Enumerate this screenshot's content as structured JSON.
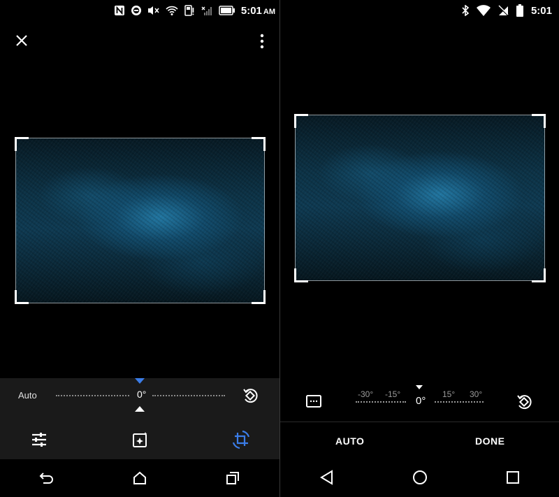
{
  "left_screen": {
    "status_bar": {
      "time": "5:01",
      "ampm": "AM",
      "icons": [
        "nfc-icon",
        "dnd-icon",
        "mute-icon",
        "wifi-icon",
        "sim-icon",
        "signal-icon",
        "battery-icon"
      ]
    },
    "top_bar": {
      "close_icon": "close-icon",
      "menu_icon": "more-vert-icon"
    },
    "straighten": {
      "auto_label": "Auto",
      "angle": "0°"
    },
    "accent_color": "#3b7de8",
    "tools": [
      "adjust-icon",
      "filters-icon",
      "crop-rotate-icon"
    ],
    "nav": [
      "back-icon",
      "home-icon",
      "recents-icon"
    ]
  },
  "right_screen": {
    "status_bar": {
      "time": "5:01",
      "icons": [
        "bluetooth-icon",
        "wifi-icon",
        "no-sim-icon",
        "battery-icon"
      ]
    },
    "angle_scale": {
      "left_ticks": [
        "-30°",
        "-15°"
      ],
      "angle": "0°",
      "right_ticks": [
        "15°",
        "30°"
      ]
    },
    "buttons": {
      "auto": "AUTO",
      "done": "DONE"
    },
    "nav": [
      "back-icon",
      "home-icon",
      "recents-icon"
    ]
  }
}
